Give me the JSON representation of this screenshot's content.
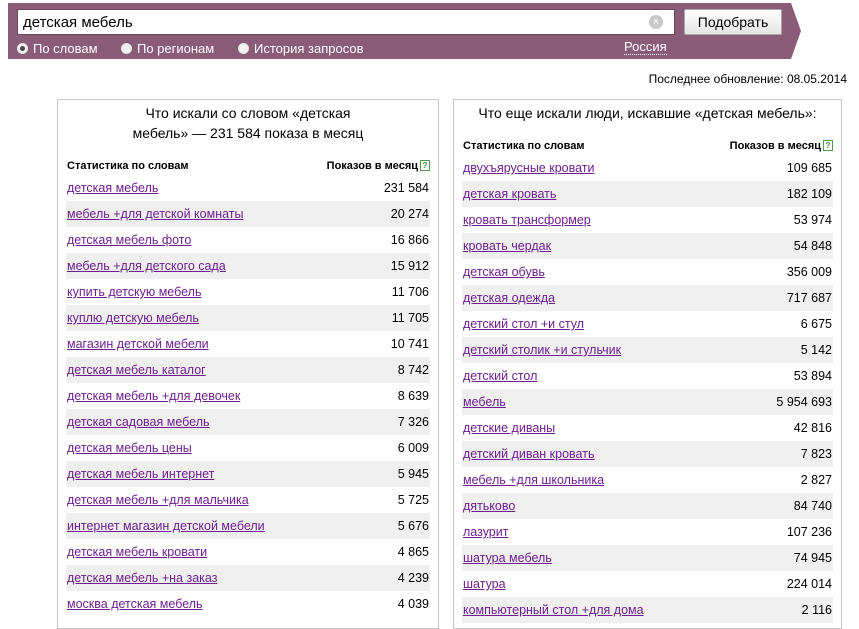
{
  "search": {
    "query": "детская мебель",
    "submit_label": "Подобрать",
    "clear_symbol": "×",
    "modes": [
      {
        "label": "По словам",
        "checked": true
      },
      {
        "label": "По регионам",
        "checked": false
      },
      {
        "label": "История запросов",
        "checked": false
      }
    ],
    "region": "Россия"
  },
  "last_update": "Последнее обновление: 08.05.2014",
  "left_panel": {
    "title_line1": "Что искали со словом «детская",
    "title_line2": "мебель» — 231 584 показа в месяц",
    "col_words": "Статистика по словам",
    "col_shows": "Показов в месяц",
    "help_symbol": "?",
    "rows": [
      {
        "phrase": "детская мебель",
        "count": "231 584"
      },
      {
        "phrase": "мебель +для детской комнаты",
        "count": "20 274"
      },
      {
        "phrase": "детская мебель фото",
        "count": "16 866"
      },
      {
        "phrase": "мебель +для детского сада",
        "count": "15 912"
      },
      {
        "phrase": "купить детскую мебель",
        "count": "11 706"
      },
      {
        "phrase": "куплю детскую мебель",
        "count": "11 705"
      },
      {
        "phrase": "магазин детской мебели",
        "count": "10 741"
      },
      {
        "phrase": "детская мебель каталог",
        "count": "8 742"
      },
      {
        "phrase": "детская мебель +для девочек",
        "count": "8 639"
      },
      {
        "phrase": "детская садовая мебель",
        "count": "7 326"
      },
      {
        "phrase": "детская мебель цены",
        "count": "6 009"
      },
      {
        "phrase": "детская мебель интернет",
        "count": "5 945"
      },
      {
        "phrase": "детская мебель +для мальчика",
        "count": "5 725"
      },
      {
        "phrase": "интернет магазин детской мебели",
        "count": "5 676"
      },
      {
        "phrase": "детская мебель кровати",
        "count": "4 865"
      },
      {
        "phrase": "детская мебель +на заказ",
        "count": "4 239"
      },
      {
        "phrase": "москва детская мебель",
        "count": "4 039"
      }
    ]
  },
  "right_panel": {
    "title": "Что еще искали люди, искавшие «детская мебель»:",
    "col_words": "Статистика по словам",
    "col_shows": "Показов в месяц",
    "help_symbol": "?",
    "rows": [
      {
        "phrase": "двухъярусные кровати",
        "count": "109 685"
      },
      {
        "phrase": "детская кровать",
        "count": "182 109"
      },
      {
        "phrase": "кровать трансформер",
        "count": "53 974"
      },
      {
        "phrase": "кровать чердак",
        "count": "54 848"
      },
      {
        "phrase": "детская обувь",
        "count": "356 009"
      },
      {
        "phrase": "детская одежда",
        "count": "717 687"
      },
      {
        "phrase": "детский стол +и стул",
        "count": "6 675"
      },
      {
        "phrase": "детский столик +и стульчик",
        "count": "5 142"
      },
      {
        "phrase": "детский стол",
        "count": "53 894"
      },
      {
        "phrase": "мебель",
        "count": "5 954 693"
      },
      {
        "phrase": "детские диваны",
        "count": "42 816"
      },
      {
        "phrase": "детский диван кровать",
        "count": "7 823"
      },
      {
        "phrase": "мебель +для школьника",
        "count": "2 827"
      },
      {
        "phrase": "дятьково",
        "count": "84 740"
      },
      {
        "phrase": "лазурит",
        "count": "107 236"
      },
      {
        "phrase": "шатура мебель",
        "count": "74 945"
      },
      {
        "phrase": "шатура",
        "count": "224 014"
      },
      {
        "phrase": "компьютерный стол +для дома",
        "count": "2 116"
      }
    ]
  },
  "colors": {
    "bar": "#8b5c78",
    "link": "#6e1f8f",
    "stripe": "#efefef"
  }
}
